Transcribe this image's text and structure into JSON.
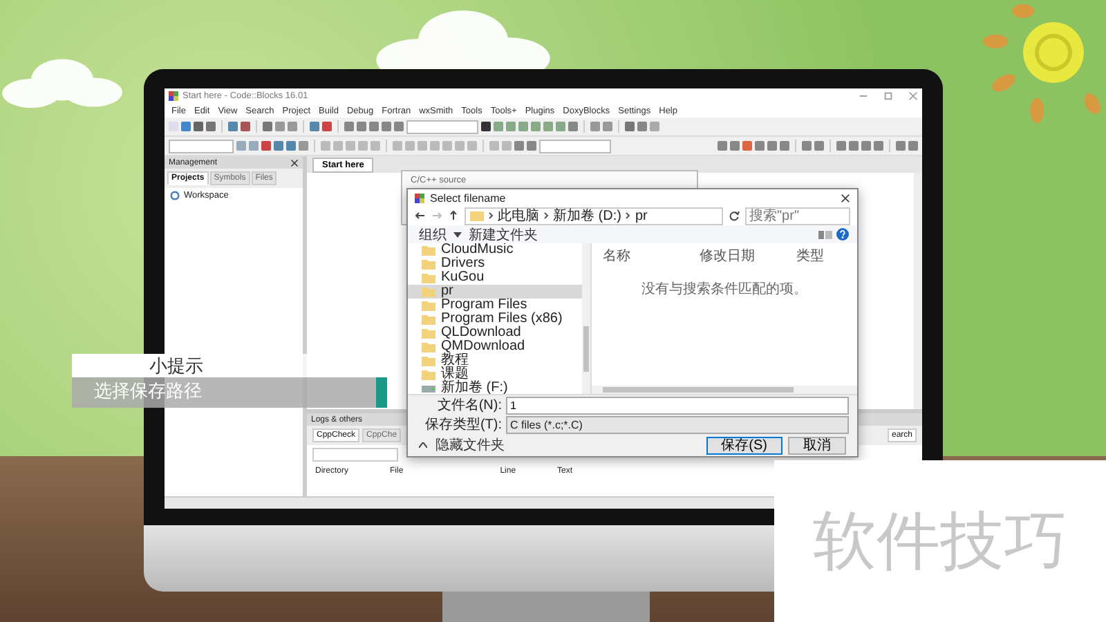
{
  "ide": {
    "title": "Start here - Code::Blocks 16.01",
    "menu": [
      "File",
      "Edit",
      "View",
      "Search",
      "Project",
      "Build",
      "Debug",
      "Fortran",
      "wxSmith",
      "Tools",
      "Tools+",
      "Plugins",
      "DoxyBlocks",
      "Settings",
      "Help"
    ],
    "management": {
      "title": "Management",
      "tabs": [
        {
          "label": "Projects",
          "selected": true
        },
        {
          "label": "Symbols",
          "selected": false
        },
        {
          "label": "Files",
          "selected": false
        }
      ],
      "tree": [
        {
          "label": "Workspace"
        }
      ]
    },
    "editor_tabs": [
      {
        "label": "Start here",
        "selected": true
      }
    ],
    "logs": {
      "title": "Logs & others",
      "tabs": [
        {
          "label": "CppCheck",
          "selected": true
        },
        {
          "label": "CppChe",
          "selected": false
        }
      ],
      "right_tab": "earch",
      "columns": [
        "Directory",
        "File",
        "Line",
        "Text"
      ]
    }
  },
  "back_dialog": {
    "title": "C/C++ source"
  },
  "dialog": {
    "title": "Select filename",
    "path": [
      "此电脑",
      "新加卷 (D:)",
      "pr"
    ],
    "search_placeholder": "搜索\"pr\"",
    "organize": "组织",
    "new_folder": "新建文件夹",
    "nav": [
      {
        "label": "CloudMusic",
        "kind": "folder",
        "selected": false
      },
      {
        "label": "Drivers",
        "kind": "folder",
        "selected": false
      },
      {
        "label": "KuGou",
        "kind": "folder",
        "selected": false
      },
      {
        "label": "pr",
        "kind": "folder",
        "selected": true
      },
      {
        "label": "Program Files",
        "kind": "folder",
        "selected": false
      },
      {
        "label": "Program Files (x86)",
        "kind": "folder",
        "selected": false
      },
      {
        "label": "QLDownload",
        "kind": "folder",
        "selected": false
      },
      {
        "label": "QMDownload",
        "kind": "folder",
        "selected": false
      },
      {
        "label": "教程",
        "kind": "folder",
        "selected": false
      },
      {
        "label": "课题",
        "kind": "folder",
        "selected": false
      },
      {
        "label": "新加卷 (F:)",
        "kind": "drive",
        "selected": false
      }
    ],
    "columns": [
      "名称",
      "修改日期",
      "类型"
    ],
    "empty_message": "没有与搜索条件匹配的项。",
    "filename_label": "文件名(N):",
    "filename": "1",
    "type_label": "保存类型(T):",
    "type": "C files (*.c;*.C)",
    "hide_folders": "隐藏文件夹",
    "buttons": [
      {
        "label": "保存(S)",
        "kind": "primary"
      },
      {
        "label": "取消",
        "kind": "normal"
      }
    ]
  },
  "caption": {
    "title": "小提示",
    "subtitle": "选择保存路径"
  },
  "corner_card": {
    "text": "软件技巧"
  }
}
